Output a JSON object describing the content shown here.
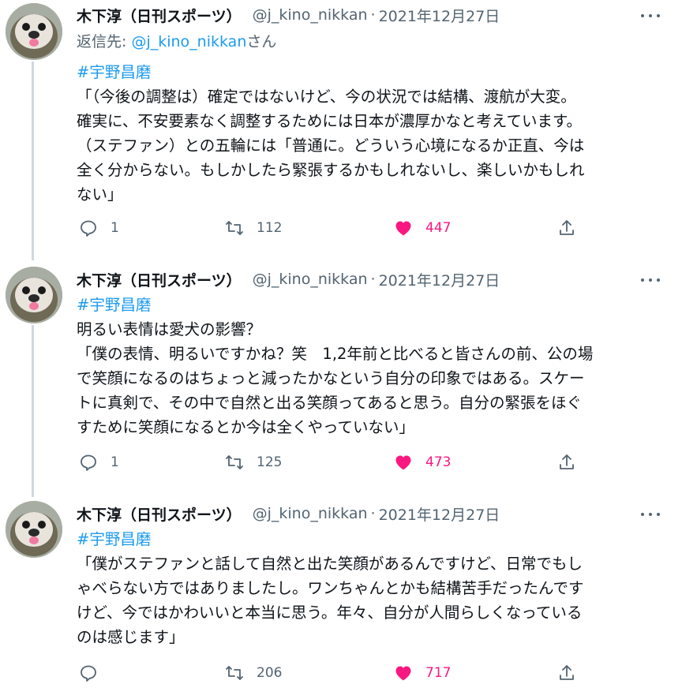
{
  "colors": {
    "link": "#1d9bf0",
    "muted": "#536471",
    "like": "#f91880",
    "thread_line": "#cfd9de"
  },
  "tweets": [
    {
      "author": {
        "name": "木下淳（日刊スポーツ）",
        "handle": "@j_kino_nikkan",
        "date": "2021年12月27日",
        "separator": "·"
      },
      "reply_to": {
        "prefix": "返信先: ",
        "handle": "@j_kino_nikkan",
        "suffix": "さん"
      },
      "hashtag": "#宇野昌磨",
      "lines": [
        "「（今後の調整は）確定ではないけど、今の状況では結構、渡航が大変。",
        "確実に、不安要素なく調整するためには日本が濃厚かなと考えています。",
        "（ステファン）との五輪には「普通に。どういう心境になるか正直、今は",
        "全く分からない。もしかしたら緊張するかもしれないし、楽しいかもしれ",
        "ない」"
      ],
      "stats": {
        "replies": "1",
        "retweets": "112",
        "likes": "447"
      }
    },
    {
      "author": {
        "name": "木下淳（日刊スポーツ）",
        "handle": "@j_kino_nikkan",
        "date": "2021年12月27日",
        "separator": "·"
      },
      "hashtag": "#宇野昌磨",
      "lines": [
        "明るい表情は愛犬の影響？",
        "「僕の表情、明るいですかね？笑　1,2年前と比べると皆さんの前、公の場",
        "で笑顔になるのはちょっと減ったかなという自分の印象ではある。スケー",
        "トに真剣で、その中で自然と出る笑顔ってあると思う。自分の緊張をほぐ",
        "すために笑顔になるとか今は全くやっていない」"
      ],
      "stats": {
        "replies": "1",
        "retweets": "125",
        "likes": "473"
      }
    },
    {
      "author": {
        "name": "木下淳（日刊スポーツ）",
        "handle": "@j_kino_nikkan",
        "date": "2021年12月27日",
        "separator": "·"
      },
      "hashtag": "#宇野昌磨",
      "lines": [
        "「僕がステファンと話して自然と出た笑顔があるんですけど、日常でもし",
        "ゃべらない方ではありましたし。ワンちゃんとかも結構苦手だったんです",
        "けど、今ではかわいいと本当に思う。年々、自分が人間らしくなっている",
        "のは感じます」"
      ],
      "stats": {
        "replies": "",
        "retweets": "206",
        "likes": "717"
      }
    }
  ],
  "icons": {
    "reply": "speech-bubble-icon",
    "retweet": "retweet-arrows-icon",
    "like": "heart-filled-icon",
    "share": "share-upload-icon",
    "more": "three-dots-icon"
  }
}
